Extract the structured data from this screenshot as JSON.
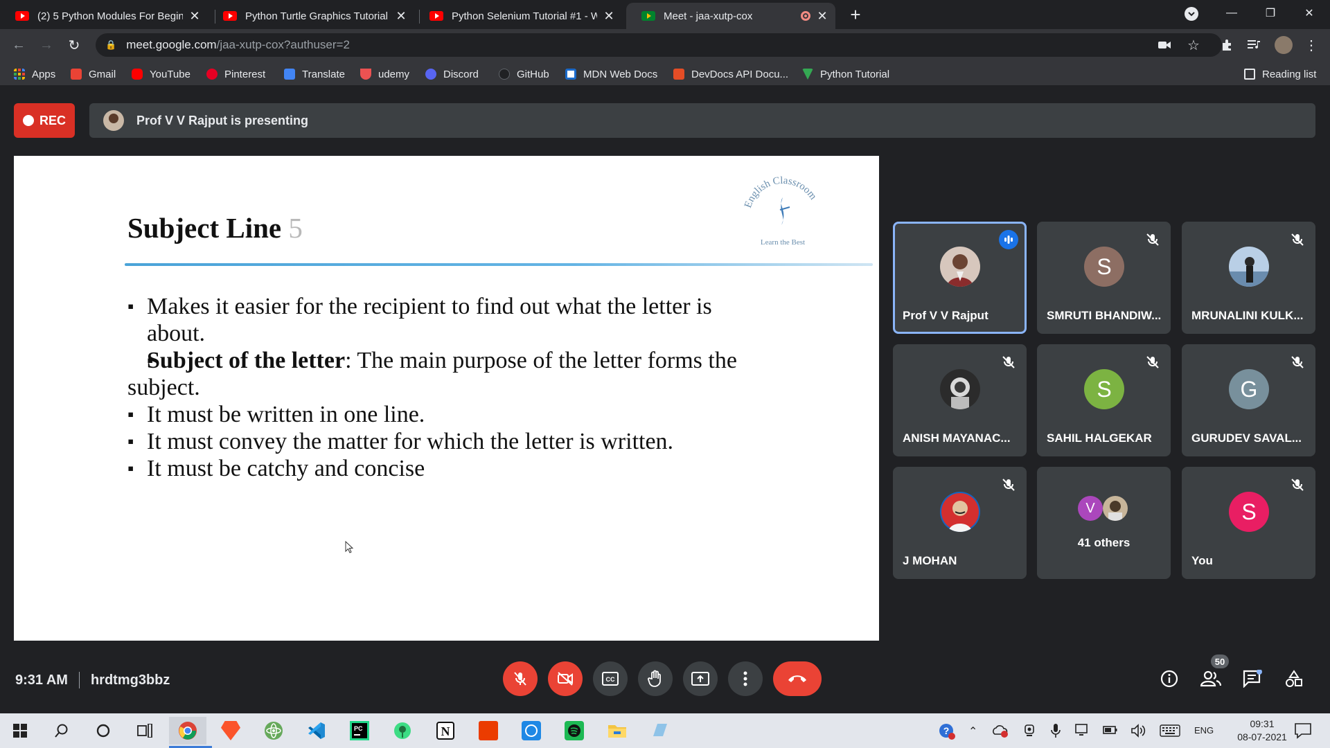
{
  "browser": {
    "tabs": [
      {
        "title": "(2) 5 Python Modules For Beginn",
        "favicon": "youtube-icon",
        "active": false
      },
      {
        "title": "Python Turtle Graphics Tutorial #",
        "favicon": "youtube-icon",
        "active": false
      },
      {
        "title": "Python Selenium Tutorial #1 - W",
        "favicon": "youtube-icon",
        "active": false
      },
      {
        "title": "Meet - jaa-xutp-cox",
        "favicon": "meet-icon",
        "active": true,
        "recording": true
      }
    ],
    "new_tab": "+",
    "address": {
      "host": "meet.google.com",
      "path": "/jaa-xutp-cox?authuser=2"
    },
    "bookmarks": [
      {
        "label": "Apps",
        "color": "#fbbc04"
      },
      {
        "label": "Gmail",
        "color": "#ea4335"
      },
      {
        "label": "YouTube",
        "color": "#ff0000"
      },
      {
        "label": "Pinterest",
        "color": "#e60023"
      },
      {
        "label": "Translate",
        "color": "#4285f4"
      },
      {
        "label": "udemy",
        "color": "#ec5252"
      },
      {
        "label": "Discord",
        "color": "#5865f2"
      },
      {
        "label": "GitHub",
        "color": "#202124"
      },
      {
        "label": "MDN Web Docs",
        "color": "#1b6ac9"
      },
      {
        "label": "DevDocs API Docu...",
        "color": "#e44d26"
      },
      {
        "label": "Python Tutorial",
        "color": "#34a853"
      }
    ],
    "reading_list": "Reading list"
  },
  "meet": {
    "rec_label": "REC",
    "presenting_text": "Prof V V Rajput is presenting",
    "slide": {
      "title": "Subject Line",
      "title_number": "5",
      "logo_text_top": "English Classroom",
      "logo_text_bottom": "Learn the Best",
      "bullets": [
        {
          "bold": "",
          "text": "Makes it easier for the recipient to find out what the letter is about."
        },
        {
          "bold": "Subject of the letter",
          "text": ": The main purpose of the letter forms the subject."
        },
        {
          "bold": "",
          "text": "It must be written in one line."
        },
        {
          "bold": "",
          "text": "It must convey  the matter for which the letter is written."
        },
        {
          "bold": "",
          "text": "It must be catchy and concise"
        }
      ]
    },
    "participants": [
      {
        "name": "Prof V V Rajput",
        "initial": "",
        "avatar_color": "#7a5a50",
        "speaking": true,
        "muted": false
      },
      {
        "name": "SMRUTI BHANDIW...",
        "initial": "S",
        "avatar_color": "#8d6e63",
        "speaking": false,
        "muted": true
      },
      {
        "name": "MRUNALINI KULK...",
        "initial": "",
        "avatar_color": "#4a6b8a",
        "speaking": false,
        "muted": true
      },
      {
        "name": "ANISH MAYANAC...",
        "initial": "",
        "avatar_color": "#2b2b2b",
        "speaking": false,
        "muted": true
      },
      {
        "name": "SAHIL HALGEKAR",
        "initial": "S",
        "avatar_color": "#7cb342",
        "speaking": false,
        "muted": true
      },
      {
        "name": "GURUDEV SAVAL...",
        "initial": "G",
        "avatar_color": "#78909c",
        "speaking": false,
        "muted": true
      },
      {
        "name": "J MOHAN",
        "initial": "",
        "avatar_color": "#d32f2f",
        "speaking": false,
        "muted": true
      },
      {
        "name": "41 others",
        "initial": "V",
        "avatar_color": "#ab47bc",
        "speaking": false,
        "muted": false
      },
      {
        "name": "You",
        "initial": "S",
        "avatar_color": "#e91e63",
        "speaking": false,
        "muted": true
      }
    ],
    "time": "9:31 AM",
    "meeting_code": "hrdtmg3bbz",
    "people_count": "50"
  },
  "taskbar": {
    "language": "ENG",
    "clock_time": "09:31",
    "clock_date": "08-07-2021"
  }
}
